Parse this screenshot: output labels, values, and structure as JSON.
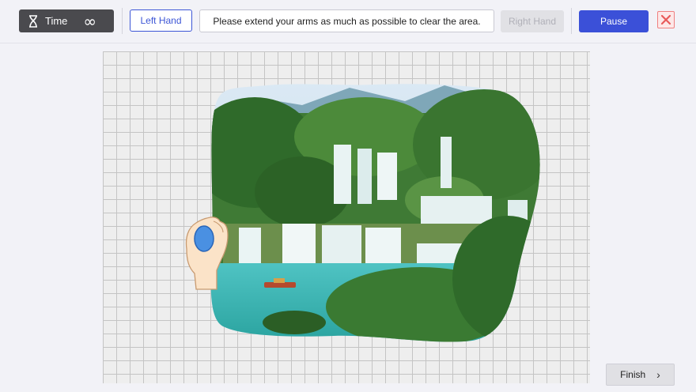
{
  "toolbar": {
    "timer_label": "Time",
    "timer_value": "∞",
    "left_hand_label": "Left Hand",
    "instruction": "Please extend your arms as much as possible to clear the area.",
    "right_hand_label": "Right Hand",
    "pause_label": "Pause"
  },
  "footer": {
    "finish_label": "Finish"
  },
  "colors": {
    "primary": "#3b50d8",
    "close_red": "#e85a5a",
    "hand_marker": "#4a90e2"
  },
  "icons": [
    "hourglass-icon",
    "infinity-icon",
    "close-icon",
    "hand-icon",
    "chevron-right-icon"
  ]
}
